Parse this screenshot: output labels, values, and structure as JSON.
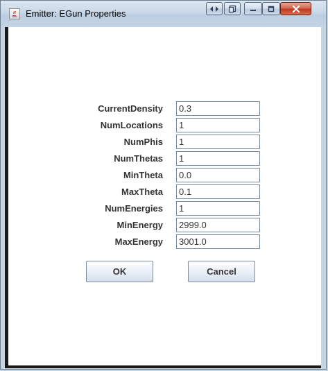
{
  "window": {
    "title": "Emitter: EGun Properties",
    "icons": [
      "java-app-icon",
      "share-icon",
      "restore-icon",
      "minimize-icon",
      "maximize-icon",
      "close-icon"
    ]
  },
  "form": {
    "fields": [
      {
        "label": "CurrentDensity",
        "value": "0.3"
      },
      {
        "label": "NumLocations",
        "value": "1"
      },
      {
        "label": "NumPhis",
        "value": "1"
      },
      {
        "label": "NumThetas",
        "value": "1"
      },
      {
        "label": "MinTheta",
        "value": "0.0"
      },
      {
        "label": "MaxTheta",
        "value": "0.1"
      },
      {
        "label": "NumEnergies",
        "value": "1"
      },
      {
        "label": "MinEnergy",
        "value": "2999.0"
      },
      {
        "label": "MaxEnergy",
        "value": "3001.0"
      }
    ]
  },
  "buttons": {
    "ok": "OK",
    "cancel": "Cancel"
  },
  "colors": {
    "titlebar": "#c9d8e8",
    "close_button": "#c7402a",
    "label_text": "#333333"
  }
}
